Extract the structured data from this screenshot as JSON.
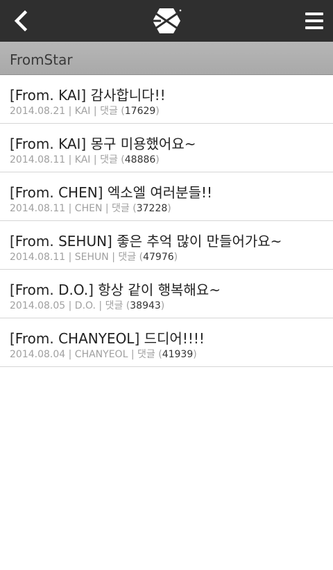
{
  "header": {
    "back_icon": "chevron-left-icon",
    "logo": "exo-logo",
    "menu_icon": "hamburger-menu-icon"
  },
  "section": {
    "title": "FromStar"
  },
  "posts": [
    {
      "title": "[From. KAI] 감사합니다!!",
      "date": "2014.08.21",
      "author": "KAI",
      "comment_label": "댓글",
      "comments": "17629"
    },
    {
      "title": "[From. KAI] 몽구 미용했어요~",
      "date": "2014.08.11",
      "author": "KAI",
      "comment_label": "댓글",
      "comments": "48886"
    },
    {
      "title": "[From. CHEN] 엑소엘 여러분들!!",
      "date": "2014.08.11",
      "author": "CHEN",
      "comment_label": "댓글",
      "comments": "37228"
    },
    {
      "title": "[From. SEHUN] 좋은 추억 많이 만들어가요~",
      "date": "2014.08.11",
      "author": "SEHUN",
      "comment_label": "댓글",
      "comments": "47976"
    },
    {
      "title": "[From. D.O.] 항상 같이 행복해요~",
      "date": "2014.08.05",
      "author": "D.O.",
      "comment_label": "댓글",
      "comments": "38943"
    },
    {
      "title": "[From. CHANYEOL] 드디어!!!!",
      "date": "2014.08.04",
      "author": "CHANYEOL",
      "comment_label": "댓글",
      "comments": "41939"
    }
  ],
  "colors": {
    "topbar": "#2f2f2f",
    "section_header": "#b0b0b0",
    "meta_text": "#a0a0a0"
  }
}
